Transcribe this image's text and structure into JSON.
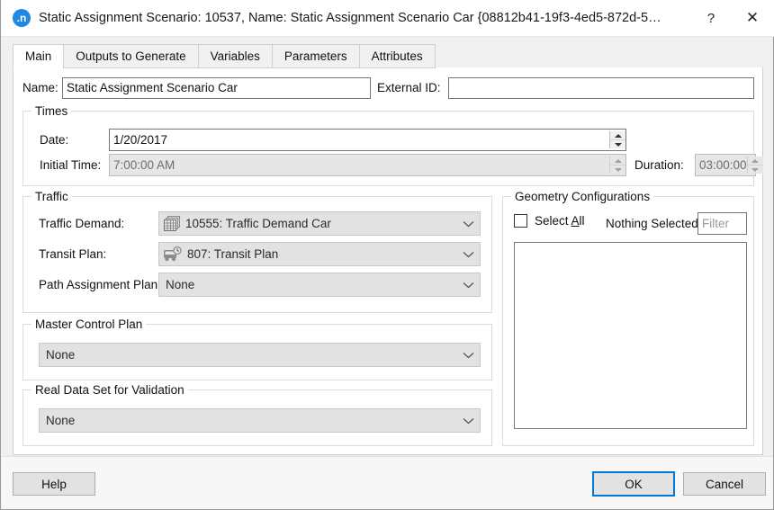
{
  "titlebar": {
    "icon": "app-logo-icon",
    "title": "Static Assignment Scenario: 10537, Name: Static Assignment Scenario Car  {08812b41-19f3-4ed5-872d-5…",
    "help_label": "?",
    "close_label": "✕"
  },
  "tabs": [
    {
      "label": "Main",
      "active": true
    },
    {
      "label": "Outputs to Generate",
      "active": false
    },
    {
      "label": "Variables",
      "active": false
    },
    {
      "label": "Parameters",
      "active": false
    },
    {
      "label": "Attributes",
      "active": false
    }
  ],
  "main": {
    "name_label": "Name:",
    "name_value": "Static Assignment Scenario Car",
    "external_id_label": "External ID:",
    "external_id_value": "",
    "times": {
      "caption": "Times",
      "date_label": "Date:",
      "date_value": "1/20/2017",
      "initial_time_label": "Initial Time:",
      "initial_time_value": "7:00:00 AM",
      "duration_label": "Duration:",
      "duration_value": "03:00:00"
    },
    "traffic": {
      "caption": "Traffic",
      "traffic_demand_label": "Traffic Demand:",
      "traffic_demand_value": "10555: Traffic Demand Car",
      "transit_plan_label": "Transit Plan:",
      "transit_plan_value": "807: Transit Plan",
      "path_assignment_label": "Path Assignment Plan:",
      "path_assignment_value": "None"
    },
    "master_control_plan": {
      "caption": "Master Control Plan",
      "value": "None"
    },
    "real_data_set": {
      "caption": "Real Data Set for Validation",
      "value": "None"
    },
    "geometry": {
      "caption": "Geometry Configurations",
      "select_all_label": "Select All",
      "select_all_accel": "A",
      "status_label": "Nothing Selected",
      "filter_placeholder": "Filter",
      "filter_value": "",
      "items": []
    }
  },
  "footer": {
    "help_label": "Help",
    "ok_label": "OK",
    "cancel_label": "Cancel"
  }
}
